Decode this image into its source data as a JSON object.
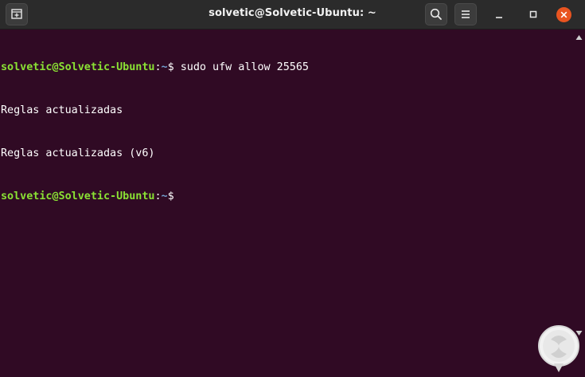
{
  "window": {
    "title": "solvetic@Solvetic-Ubuntu: ~"
  },
  "titlebar": {
    "new_tab_icon": "new-tab-icon",
    "search_icon": "search-icon",
    "menu_icon": "hamburger-menu-icon",
    "minimize_icon": "minimize-icon",
    "maximize_icon": "maximize-icon",
    "close_icon": "close-icon"
  },
  "terminal": {
    "lines": [
      {
        "user": "solvetic@Solvetic-Ubuntu",
        "sep": ":",
        "path": "~",
        "sym": "$ ",
        "cmd": "sudo ufw allow 25565"
      },
      {
        "text": "Reglas actualizadas"
      },
      {
        "text": "Reglas actualizadas (v6)"
      },
      {
        "user": "solvetic@Solvetic-Ubuntu",
        "sep": ":",
        "path": "~",
        "sym": "$",
        "cmd": ""
      }
    ]
  },
  "colors": {
    "background": "#300a24",
    "prompt_user": "#8ae234",
    "prompt_path": "#729fcf",
    "close_button": "#e95420"
  },
  "watermark": {
    "logo": "solvetic-logo"
  }
}
